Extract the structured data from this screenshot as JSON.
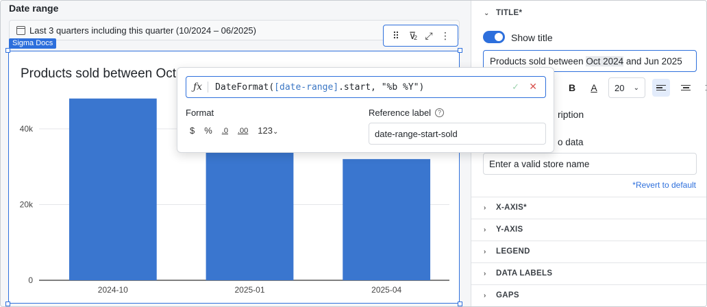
{
  "date_range": {
    "label": "Date range",
    "value": "Last 3 quarters including this quarter (10/2024 – 06/2025)"
  },
  "sigma_tag": "Sigma Docs",
  "toolbar": {
    "filter_count": "2"
  },
  "chart": {
    "title_visible": "Products sold between Oct"
  },
  "chart_data": {
    "type": "bar",
    "categories": [
      "2024-10",
      "2025-01",
      "2025-04"
    ],
    "values": [
      48000,
      41000,
      32000
    ],
    "yticks": [
      0,
      20000,
      40000
    ],
    "ytick_labels": [
      "0",
      "20k",
      "40k"
    ],
    "ylim": [
      0,
      48500
    ],
    "bar_color": "#3a76cf",
    "grid": true
  },
  "formula": {
    "fx_symbol": "ƒx",
    "code_prefix": "DateFormat(",
    "code_ref": "[date-range]",
    "code_suffix": ".start, \"%b %Y\")",
    "format_label": "Format",
    "format_options": [
      "$",
      "%",
      ".0",
      ".00",
      "123"
    ],
    "reference_label": "Reference label",
    "reference_value": "date-range-start-sold"
  },
  "panel": {
    "title_section": "TITLE*",
    "show_title": "Show title",
    "title_text_before": "Products sold between ",
    "title_token_1": "Oct 2024",
    "title_text_after": " and Jun 2025",
    "font_size": "20",
    "description_fragment": "ription",
    "no_data_fragment": "o data",
    "no_data_value": "Enter a valid store name",
    "revert": "*Revert to default",
    "sections": [
      "X-AXIS*",
      "Y-AXIS",
      "LEGEND",
      "DATA LABELS",
      "GAPS"
    ]
  },
  "colors": {
    "accent": "#2d6fdc",
    "bar": "#3a76cf"
  }
}
